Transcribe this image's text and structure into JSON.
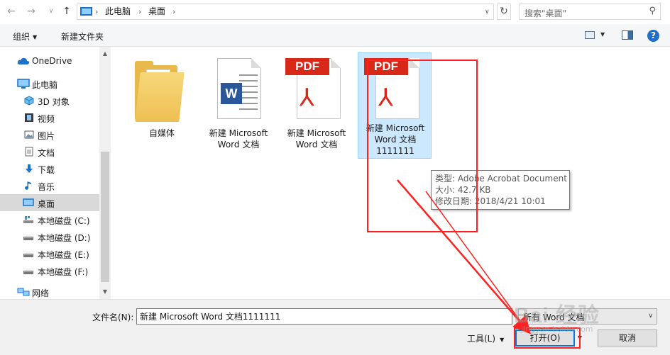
{
  "address_bar": {
    "crumbs": [
      "此电脑",
      "桌面"
    ],
    "search_placeholder": "搜索\"桌面\""
  },
  "command_bar": {
    "organize": "组织",
    "new_folder": "新建文件夹"
  },
  "sidebar": {
    "items": [
      {
        "label": "OneDrive",
        "icon": "cloud-icon"
      },
      {
        "label": "此电脑",
        "icon": "computer-icon"
      },
      {
        "label": "3D 对象",
        "icon": "cube-icon"
      },
      {
        "label": "视频",
        "icon": "film-icon"
      },
      {
        "label": "图片",
        "icon": "picture-icon"
      },
      {
        "label": "文档",
        "icon": "document-icon"
      },
      {
        "label": "下载",
        "icon": "download-icon"
      },
      {
        "label": "音乐",
        "icon": "music-icon"
      },
      {
        "label": "桌面",
        "icon": "desktop-icon",
        "selected": true
      },
      {
        "label": "本地磁盘 (C:)",
        "icon": "drive-icon"
      },
      {
        "label": "本地磁盘 (D:)",
        "icon": "drive-icon"
      },
      {
        "label": "本地磁盘 (E:)",
        "icon": "drive-icon"
      },
      {
        "label": "本地磁盘 (F:)",
        "icon": "drive-icon"
      },
      {
        "label": "网络",
        "icon": "network-icon"
      }
    ]
  },
  "files": [
    {
      "name": "自媒体",
      "type": "folder"
    },
    {
      "name_line1": "新建 Microsoft",
      "name_line2": "Word 文档",
      "type": "word"
    },
    {
      "name_line1": "新建 Microsoft",
      "name_line2": "Word 文档",
      "type": "pdf",
      "badge": "PDF"
    },
    {
      "name_line1": "新建 Microsoft",
      "name_line2": "Word 文档",
      "name_line3": "1111111",
      "type": "pdf",
      "badge": "PDF",
      "selected": true
    }
  ],
  "tooltip": {
    "type_line": "类型: Adobe Acrobat Document",
    "size_line": "大小: 42.7 KB",
    "modified_line": "修改日期: 2018/4/21 10:01"
  },
  "bottom": {
    "filename_label": "文件名(N):",
    "filename_value": "新建 Microsoft Word 文档1111111",
    "filetype_value": "所有 Word 文档",
    "tools_label": "工具(L)",
    "open_label": "打开(O)",
    "cancel_label": "取消"
  },
  "watermark": {
    "text": "Bai 经验",
    "sub": "jingyan.baidu.com"
  },
  "colors": {
    "accent": "#0078d7",
    "selection": "#cce8ff",
    "annotation": "#ff2020",
    "pdf_red": "#d92818",
    "word_blue": "#2b579a"
  }
}
